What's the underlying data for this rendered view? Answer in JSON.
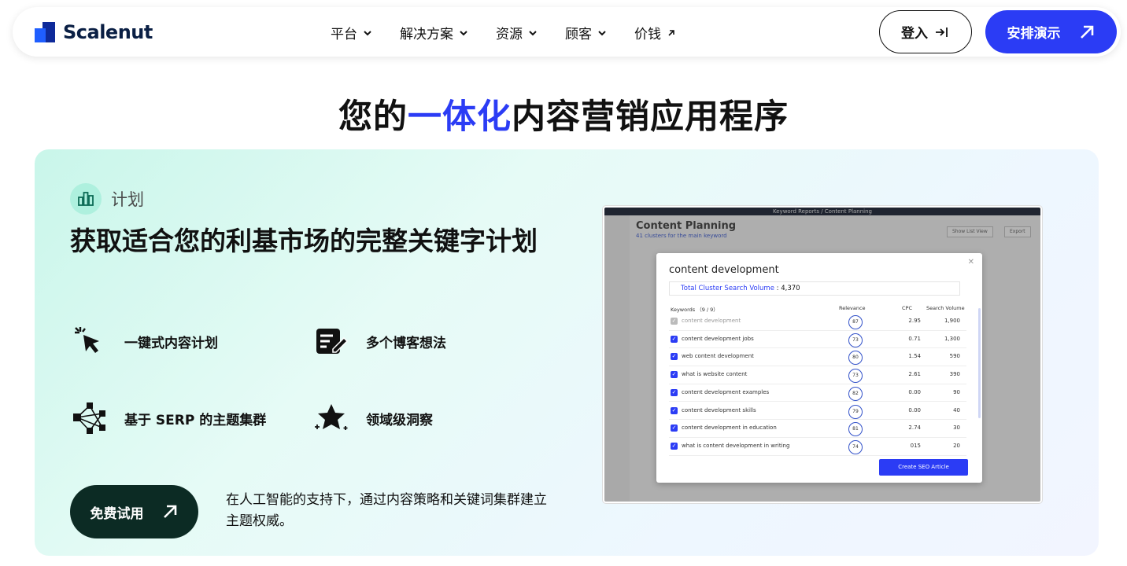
{
  "nav": {
    "logo_text": "Scalenut",
    "menu": [
      {
        "label": "平台",
        "icon": "chevron-down-icon"
      },
      {
        "label": "解决方案",
        "icon": "chevron-down-icon"
      },
      {
        "label": "资源",
        "icon": "chevron-down-icon"
      },
      {
        "label": "顾客",
        "icon": "chevron-down-icon"
      },
      {
        "label": "价钱",
        "icon": "arrow-up-right-icon"
      }
    ],
    "login_label": "登入",
    "demo_label": "安排演示"
  },
  "headline": {
    "before": "您的",
    "accent": "一体化",
    "after": "内容营销应用程序"
  },
  "card": {
    "tag": "计划",
    "title": "获取适合您的利基市场的完整关键字计划",
    "features": [
      {
        "label": "一键式内容计划",
        "icon": "cursor-click-icon"
      },
      {
        "label": "多个博客想法",
        "icon": "notes-edit-icon"
      },
      {
        "label": "基于 SERP 的主题集群",
        "icon": "cluster-network-icon"
      },
      {
        "label": "领域级洞察",
        "icon": "sparkle-star-icon"
      }
    ],
    "trial_label": "免费试用",
    "trial_desc": "在人工智能的支持下，通过内容策略和关键词集群建立主题权威。"
  },
  "screenshot": {
    "topbar": "Keyword Reports / Content Planning",
    "title": "Content Planning",
    "subtitle": "41 clusters for the main keyword",
    "btn_list": "Show List View",
    "btn_export": "Export",
    "modal": {
      "title": "content development",
      "vol_label": "Total Cluster Search Volume",
      "vol_value": "4,370",
      "col_keywords": "Keywords （9 / 9）",
      "col_relevance": "Relevance",
      "col_cpc": "CPC",
      "col_sv": "Search Volume",
      "rows": [
        {
          "kw": "content development",
          "rel": "87",
          "cpc": "2.95",
          "sv": "1,900",
          "off": true
        },
        {
          "kw": "content development jobs",
          "rel": "73",
          "cpc": "0.71",
          "sv": "1,300"
        },
        {
          "kw": "web content development",
          "rel": "80",
          "cpc": "1.54",
          "sv": "590"
        },
        {
          "kw": "what is website content",
          "rel": "73",
          "cpc": "2.61",
          "sv": "390"
        },
        {
          "kw": "content development examples",
          "rel": "82",
          "cpc": "0.00",
          "sv": "90"
        },
        {
          "kw": "content development skills",
          "rel": "79",
          "cpc": "0.00",
          "sv": "40"
        },
        {
          "kw": "content development in education",
          "rel": "81",
          "cpc": "2.74",
          "sv": "30"
        },
        {
          "kw": "what is content development in writing",
          "rel": "74",
          "cpc": "015",
          "sv": "20"
        }
      ],
      "cta": "Create SEO Article"
    }
  },
  "colors": {
    "accent": "#2b3cf5",
    "dark_green": "#0c2b24"
  }
}
